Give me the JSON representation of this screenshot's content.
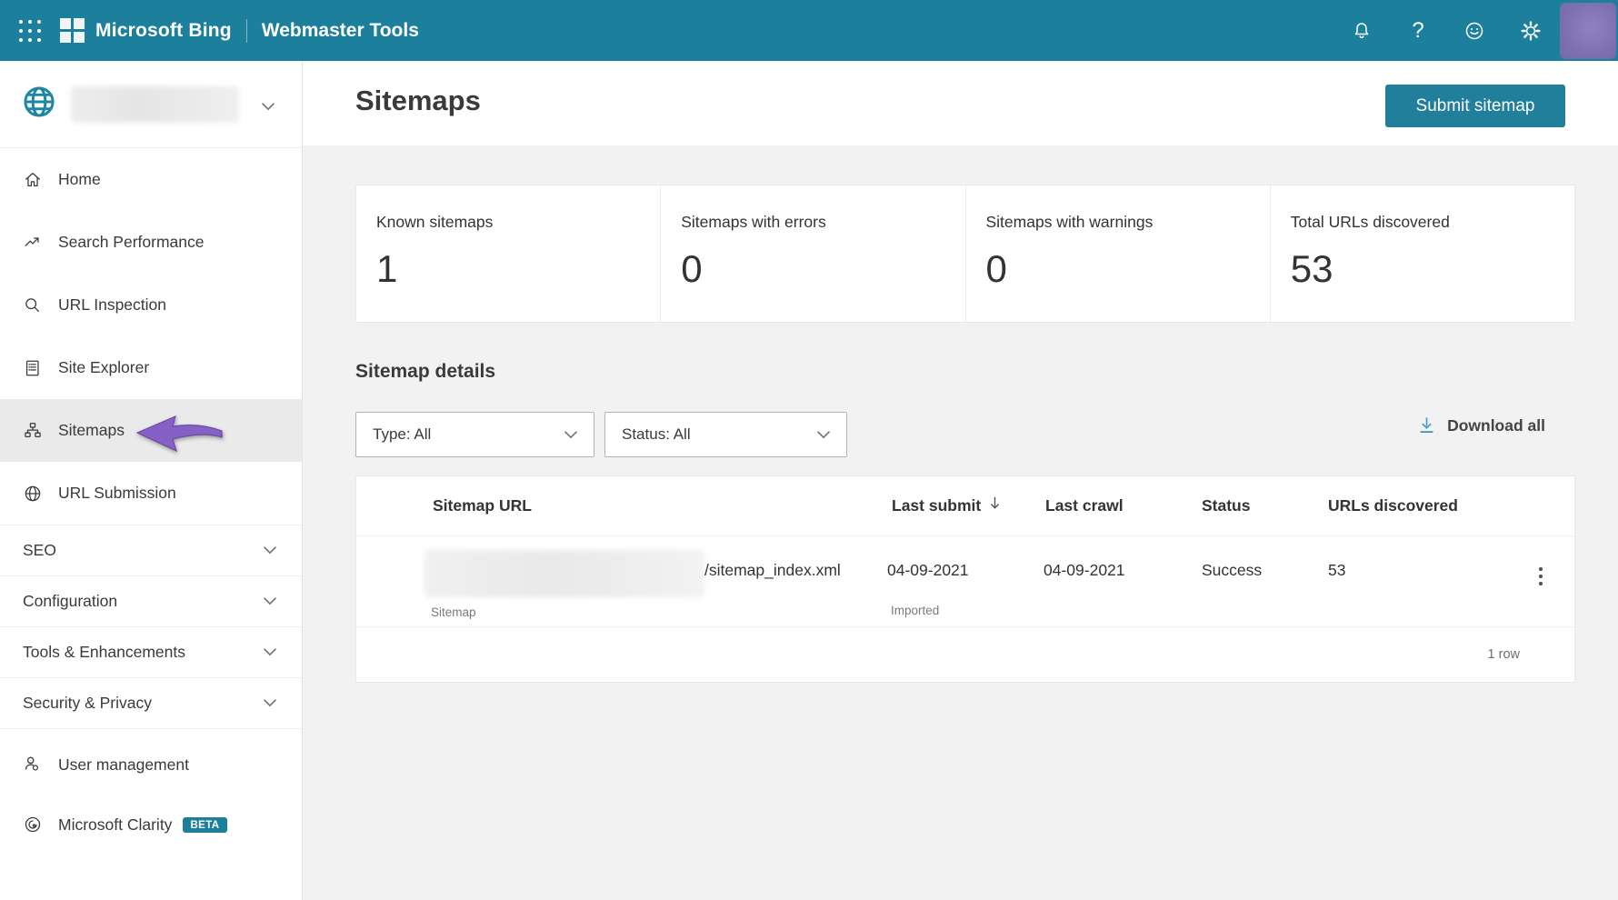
{
  "colors": {
    "header_bg": "#1c7f9c",
    "accent_teal": "#217f9c",
    "page_bg": "#f2f2f2",
    "selected_item_bg": "#eaeaea",
    "annotation_arrow": "#8661c5",
    "download_icon": "#4aa3c6"
  },
  "topbar": {
    "brand": "Microsoft Bing",
    "product": "Webmaster Tools"
  },
  "sidebar": {
    "nav": [
      {
        "label": "Home"
      },
      {
        "label": "Search Performance"
      },
      {
        "label": "URL Inspection"
      },
      {
        "label": "Site Explorer"
      },
      {
        "label": "Sitemaps",
        "selected": true
      },
      {
        "label": "URL Submission"
      }
    ],
    "sections": [
      {
        "label": "SEO"
      },
      {
        "label": "Configuration"
      },
      {
        "label": "Tools & Enhancements"
      },
      {
        "label": "Security & Privacy"
      }
    ],
    "footer": [
      {
        "label": "User management"
      },
      {
        "label": "Microsoft Clarity",
        "badge": "BETA"
      }
    ]
  },
  "page": {
    "title": "Sitemaps",
    "submit_button": "Submit sitemap"
  },
  "stats": [
    {
      "label": "Known sitemaps",
      "value": "1"
    },
    {
      "label": "Sitemaps with errors",
      "value": "0"
    },
    {
      "label": "Sitemaps with warnings",
      "value": "0"
    },
    {
      "label": "Total URLs discovered",
      "value": "53"
    }
  ],
  "details": {
    "heading": "Sitemap details",
    "type_filter": "Type: All",
    "status_filter": "Status: All",
    "download_all": "Download all"
  },
  "table": {
    "columns": {
      "url": "Sitemap URL",
      "last_submit": "Last submit",
      "last_crawl": "Last crawl",
      "status": "Status",
      "urls": "URLs discovered"
    },
    "rows": [
      {
        "url_suffix": "/sitemap_index.xml",
        "type_label": "Sitemap",
        "last_submit": "04-09-2021",
        "submit_source": "Imported",
        "last_crawl": "04-09-2021",
        "status": "Success",
        "urls": "53"
      }
    ],
    "footer_count": "1 row"
  }
}
